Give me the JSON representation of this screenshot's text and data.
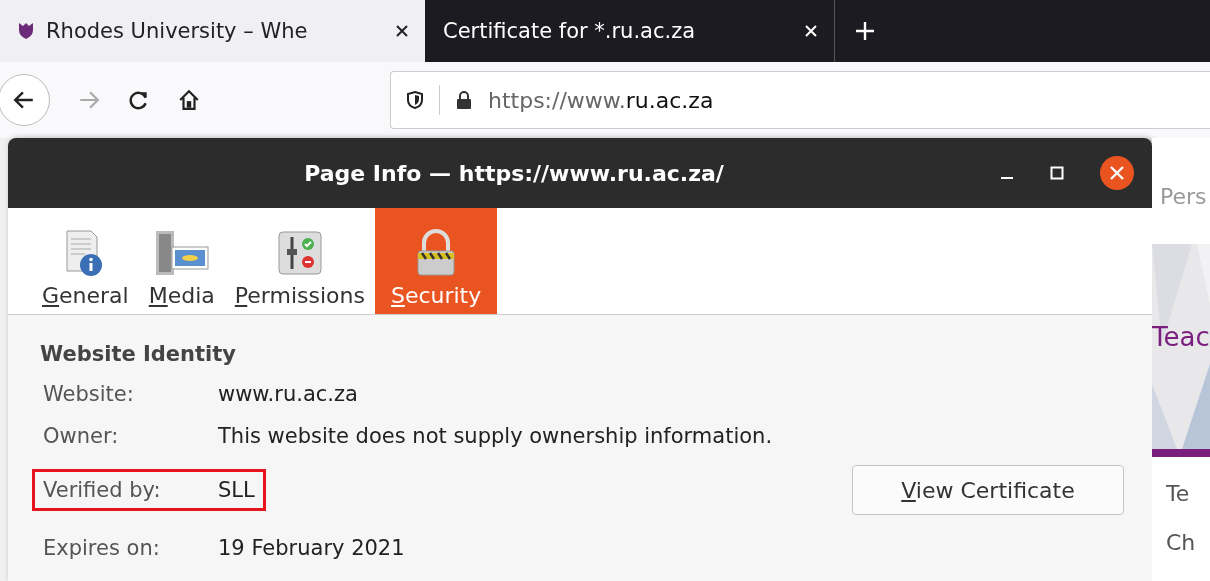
{
  "browser_tabs": [
    {
      "title": "Rhodes University – Whe",
      "selected": true
    },
    {
      "title": "Certificate for *.ru.ac.za",
      "selected": false
    }
  ],
  "address_bar": {
    "url": "https://www.**ru.ac.za**"
  },
  "dialog": {
    "title": "Page Info — https://www.ru.ac.za/",
    "tabs": [
      {
        "label": "General",
        "kind": "general",
        "selected": false
      },
      {
        "label": "Media",
        "kind": "media",
        "selected": false
      },
      {
        "label": "Permissions",
        "kind": "permissions",
        "selected": false
      },
      {
        "label": "Security",
        "kind": "security",
        "selected": true
      }
    ],
    "section_title": "Website Identity",
    "fields": [
      {
        "label": "Website:",
        "value": "www.ru.ac.za",
        "highlighted": false
      },
      {
        "label": "Owner:",
        "value": "This website does not supply ownership information.",
        "highlighted": false
      },
      {
        "label": "Verified by:",
        "value": "SLL",
        "highlighted": true
      },
      {
        "label": "Expires on:",
        "value": "19 February 2021",
        "highlighted": false
      }
    ],
    "button": "View Certificate"
  },
  "background_page": {
    "top_link": "Pers",
    "banner_heading": "Teac",
    "items": [
      "Te",
      "Ch"
    ]
  }
}
